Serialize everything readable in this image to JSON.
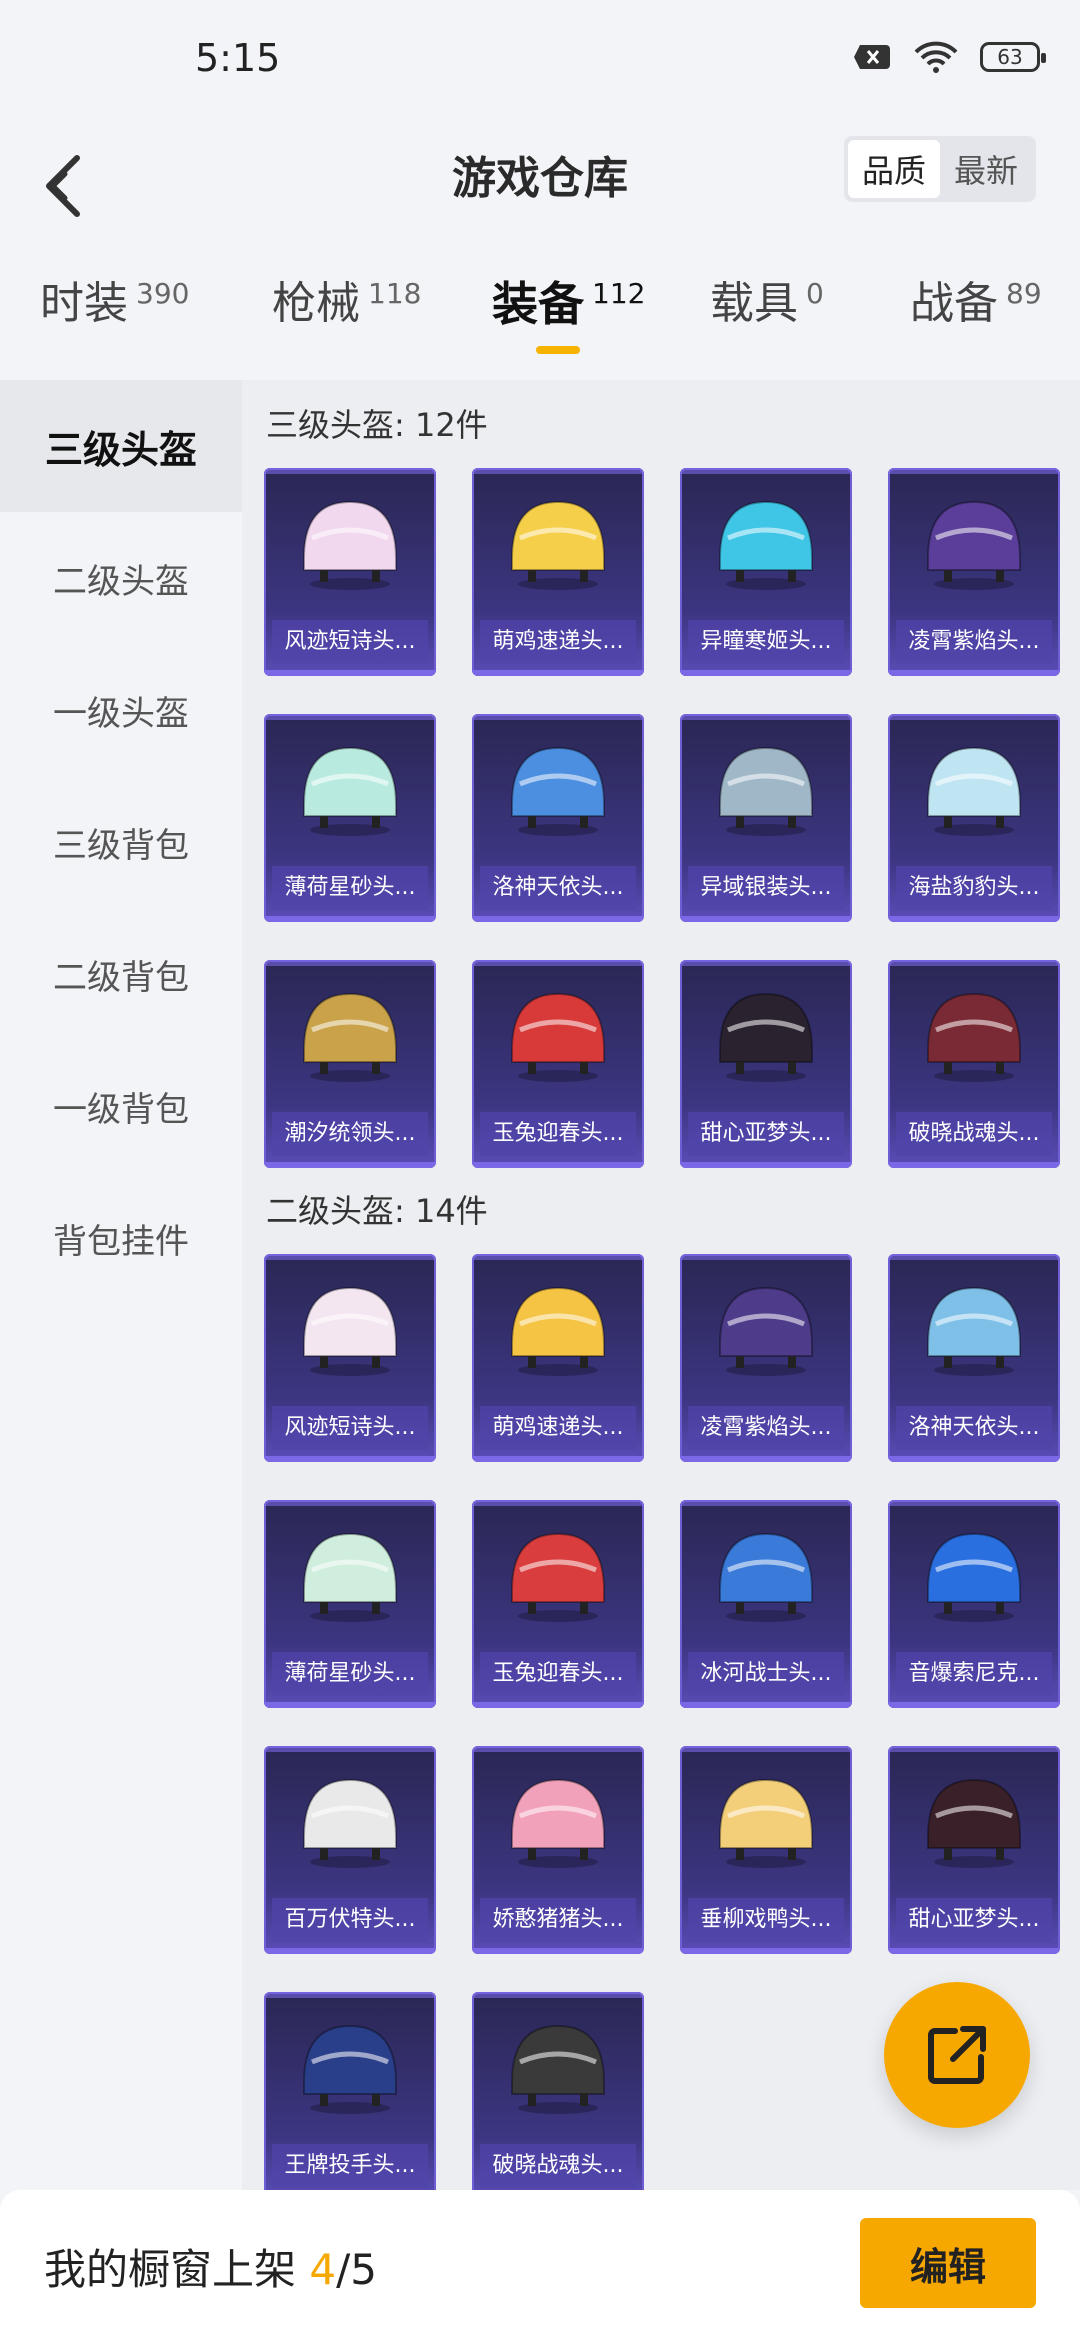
{
  "status": {
    "time": "5:15",
    "battery": "63"
  },
  "header": {
    "title": "游戏仓库",
    "sort": [
      "品质",
      "最新"
    ]
  },
  "tabs": [
    {
      "label": "时装",
      "count": "390"
    },
    {
      "label": "枪械",
      "count": "118"
    },
    {
      "label": "装备",
      "count": "112"
    },
    {
      "label": "载具",
      "count": "0"
    },
    {
      "label": "战备",
      "count": "89"
    }
  ],
  "sidebar": [
    "三级头盔",
    "二级头盔",
    "一级头盔",
    "三级背包",
    "二级背包",
    "一级背包",
    "背包挂件"
  ],
  "sections": [
    {
      "title": "三级头盔: 12件",
      "items": [
        {
          "name": "风迹短诗头...",
          "color": "#f2d8ef"
        },
        {
          "name": "萌鸡速递头...",
          "color": "#f6cf4a"
        },
        {
          "name": "异瞳寒姬头...",
          "color": "#3fc5e6"
        },
        {
          "name": "凌霄紫焰头...",
          "color": "#5a3e9a"
        },
        {
          "name": "薄荷星砂头...",
          "color": "#b9eadf"
        },
        {
          "name": "洛神天依头...",
          "color": "#4c8fe0"
        },
        {
          "name": "异域银装头...",
          "color": "#9fb7c7"
        },
        {
          "name": "海盐豹豹头...",
          "color": "#bfe4f2"
        },
        {
          "name": "潮汐统领头...",
          "color": "#c9a24a"
        },
        {
          "name": "玉兔迎春头...",
          "color": "#d83a3a"
        },
        {
          "name": "甜心亚梦头...",
          "color": "#2b2230"
        },
        {
          "name": "破晓战魂头...",
          "color": "#7a2a34"
        }
      ]
    },
    {
      "title": "二级头盔: 14件",
      "items": [
        {
          "name": "风迹短诗头...",
          "color": "#f3e6f1"
        },
        {
          "name": "萌鸡速递头...",
          "color": "#f6c444"
        },
        {
          "name": "凌霄紫焰头...",
          "color": "#4e3b8a"
        },
        {
          "name": "洛神天依头...",
          "color": "#7fc0e8"
        },
        {
          "name": "薄荷星砂头...",
          "color": "#cfeedd"
        },
        {
          "name": "玉兔迎春头...",
          "color": "#d93d3d"
        },
        {
          "name": "冰河战士头...",
          "color": "#3a7ad8"
        },
        {
          "name": "音爆索尼克...",
          "color": "#2a6fe0"
        },
        {
          "name": "百万伏特头...",
          "color": "#e9e9e9"
        },
        {
          "name": "娇憨猪猪头...",
          "color": "#f2a1ba"
        },
        {
          "name": "垂柳戏鸭头...",
          "color": "#f3cf7a"
        },
        {
          "name": "甜心亚梦头...",
          "color": "#3a2028"
        },
        {
          "name": "王牌投手头...",
          "color": "#2a3f8a"
        },
        {
          "name": "破晓战魂头...",
          "color": "#3a3a3a"
        }
      ]
    }
  ],
  "bottom": {
    "label": "我的橱窗上架",
    "count": "4",
    "total": "/5",
    "edit": "编辑"
  }
}
